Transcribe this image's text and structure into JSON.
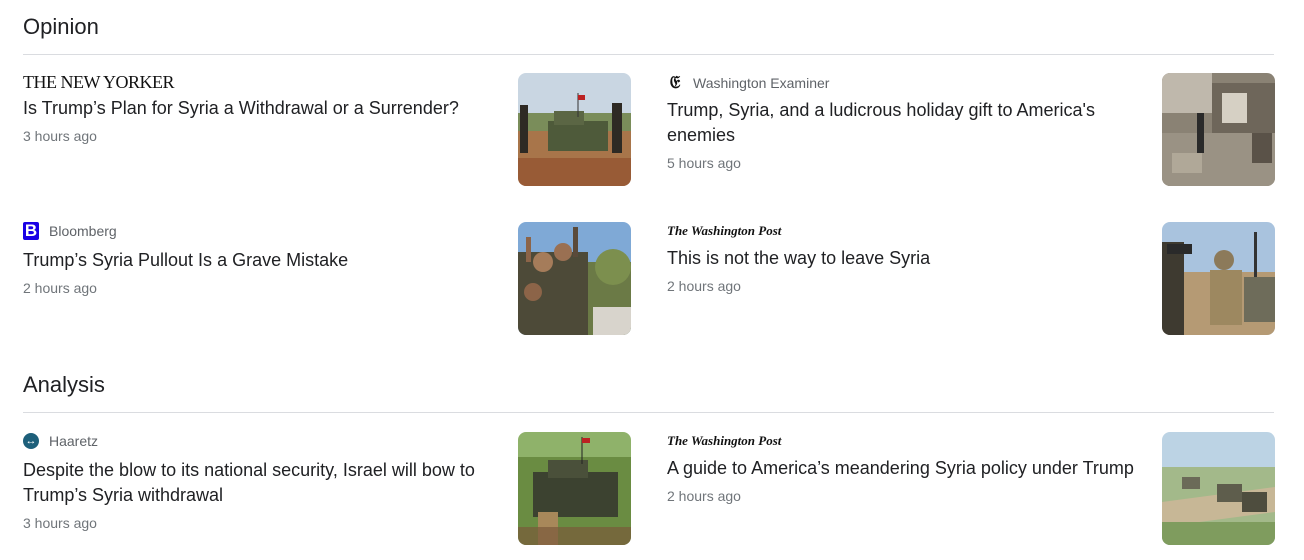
{
  "sections": [
    {
      "title": "Opinion",
      "cards": [
        {
          "source": "THE NEW YORKER",
          "logo": "new-yorker-wordmark",
          "headline": "Is Trump’s Plan for Syria a Withdrawal or a Surrender?",
          "time": "3 hours ago"
        },
        {
          "source": "Washington Examiner",
          "logo": "washington-examiner-icon",
          "headline": "Trump, Syria, and a ludicrous holiday gift to America's enemies",
          "time": "5 hours ago"
        },
        {
          "source": "Bloomberg",
          "logo": "bloomberg-icon",
          "headline": "Trump’s Syria Pullout Is a Grave Mistake",
          "time": "2 hours ago"
        },
        {
          "source": "The Washington Post",
          "logo": "washington-post-wordmark",
          "headline": "This is not the way to leave Syria",
          "time": "2 hours ago"
        }
      ]
    },
    {
      "title": "Analysis",
      "cards": [
        {
          "source": "Haaretz",
          "logo": "haaretz-icon",
          "headline": "Despite the blow to its national security, Israel will bow to Trump’s Syria withdrawal",
          "time": "3 hours ago"
        },
        {
          "source": "The Washington Post",
          "logo": "washington-post-wordmark",
          "headline": "A guide to America’s meandering Syria policy under Trump",
          "time": "2 hours ago"
        }
      ]
    }
  ],
  "colors": {
    "bloomberg": "#1a00e5",
    "haaretz": "#1d5f7a",
    "divider": "#dadce0"
  }
}
